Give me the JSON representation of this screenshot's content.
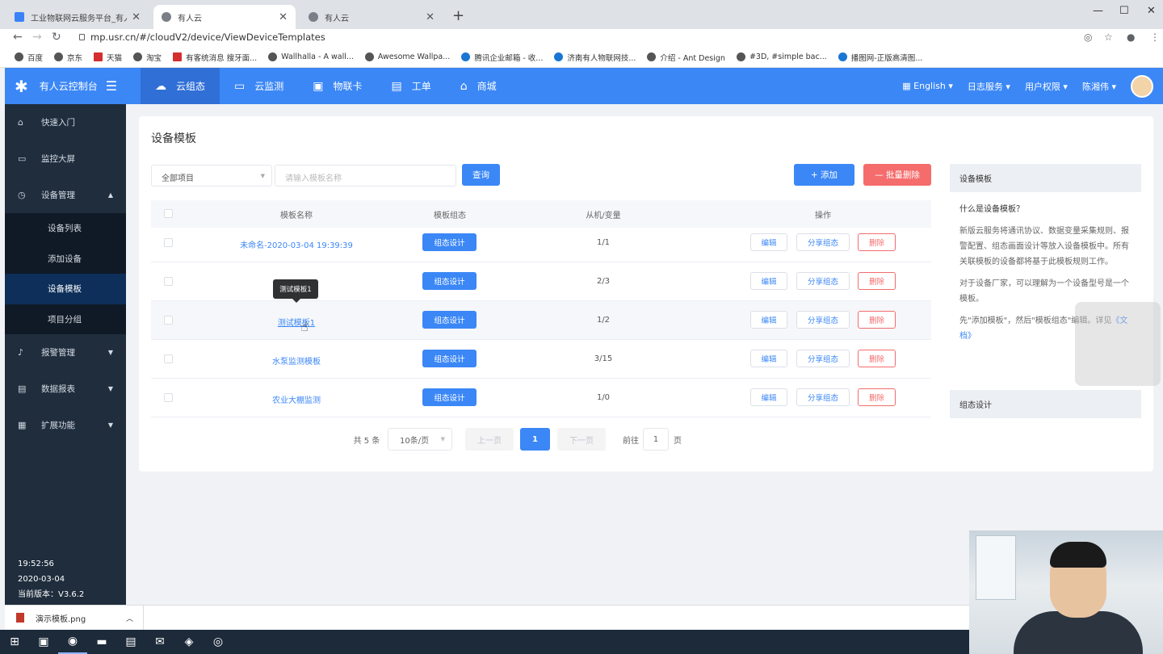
{
  "browser": {
    "tabs": [
      {
        "title": "工业物联网云服务平台_有人科技"
      },
      {
        "title": "有人云"
      },
      {
        "title": "有人云"
      }
    ],
    "url": "mp.usr.cn/#/cloudV2/device/ViewDeviceTemplates",
    "bookmarks": [
      "百度",
      "京东",
      "天猫",
      "淘宝",
      "有客统消息 搜牙面...",
      "Wallhalla - A wall...",
      "Awesome Wallpa...",
      "腾讯企业邮箱 - 收...",
      "济南有人物联网技...",
      "介绍 - Ant Design",
      "#3D, #simple bac...",
      "播图网-正版高清图..."
    ]
  },
  "header": {
    "brand": "有人云控制台",
    "nav": [
      {
        "label": "云组态",
        "icon": "cloud-icon",
        "active": true
      },
      {
        "label": "云监测",
        "icon": "monitor-icon",
        "active": false
      },
      {
        "label": "物联卡",
        "icon": "card-icon",
        "active": false
      },
      {
        "label": "工单",
        "icon": "ticket-icon",
        "active": false
      },
      {
        "label": "商城",
        "icon": "shop-icon",
        "active": false
      }
    ],
    "right": {
      "language": "English",
      "log": "日志服务",
      "perm": "用户权限",
      "user": "陈湘伟"
    }
  },
  "sidebar": {
    "items": [
      {
        "label": "快速入门",
        "icon": "home-icon"
      },
      {
        "label": "监控大屏",
        "icon": "screen-icon"
      },
      {
        "label": "设备管理",
        "icon": "device-icon",
        "expanded": true
      },
      {
        "label": "报警管理",
        "icon": "bell-icon"
      },
      {
        "label": "数据报表",
        "icon": "report-icon"
      },
      {
        "label": "扩展功能",
        "icon": "apps-icon"
      }
    ],
    "sub": [
      "设备列表",
      "添加设备",
      "设备模板",
      "项目分组"
    ],
    "time": "19:52:56",
    "date": "2020-03-04",
    "version": "当前版本：V3.6.2"
  },
  "main": {
    "title": "设备模板",
    "select": "全部项目",
    "search_placeholder": "请输入模板名称",
    "query_btn": "查询",
    "add_btn": "+ 添加",
    "batch_del_btn": "— 批量删除",
    "columns": [
      "模板名称",
      "模板组态",
      "从机/变量",
      "操作"
    ],
    "rows": [
      {
        "name": "未命名-2020-03-04 19:39:39",
        "ratio": "1/1"
      },
      {
        "name": "",
        "ratio": "2/3"
      },
      {
        "name": "测试模板1",
        "ratio": "1/2"
      },
      {
        "name": "水泵监测模板",
        "ratio": "3/15"
      },
      {
        "name": "农业大棚监测",
        "ratio": "1/0"
      }
    ],
    "zutai_btn": "组态设计",
    "edit_btn": "编辑",
    "share_btn": "分享组态",
    "del_btn": "删除",
    "tooltip": "测试模板1",
    "pager": {
      "total": "共 5 条",
      "size": "10条/页",
      "prev": "上一页",
      "current": "1",
      "next": "下一页",
      "goto": "前往",
      "page_input": "1",
      "page_unit": "页"
    }
  },
  "help": {
    "head": "设备模板",
    "q": "什么是设备模板？",
    "p1": "新版云服务将通讯协议、数据变量采集规则、报警配置、组态画面设计等放入设备模板中。所有关联模板的设备都将基于此模板规则工作。",
    "p2": "对于设备厂家，可以理解为一个设备型号是一个模板。",
    "p3": "先\"添加模板\"，然后\"模板组态\"编辑。详见",
    "link": "《文档》",
    "head2": "组态设计"
  },
  "downloads": {
    "file": "演示模板.png"
  }
}
